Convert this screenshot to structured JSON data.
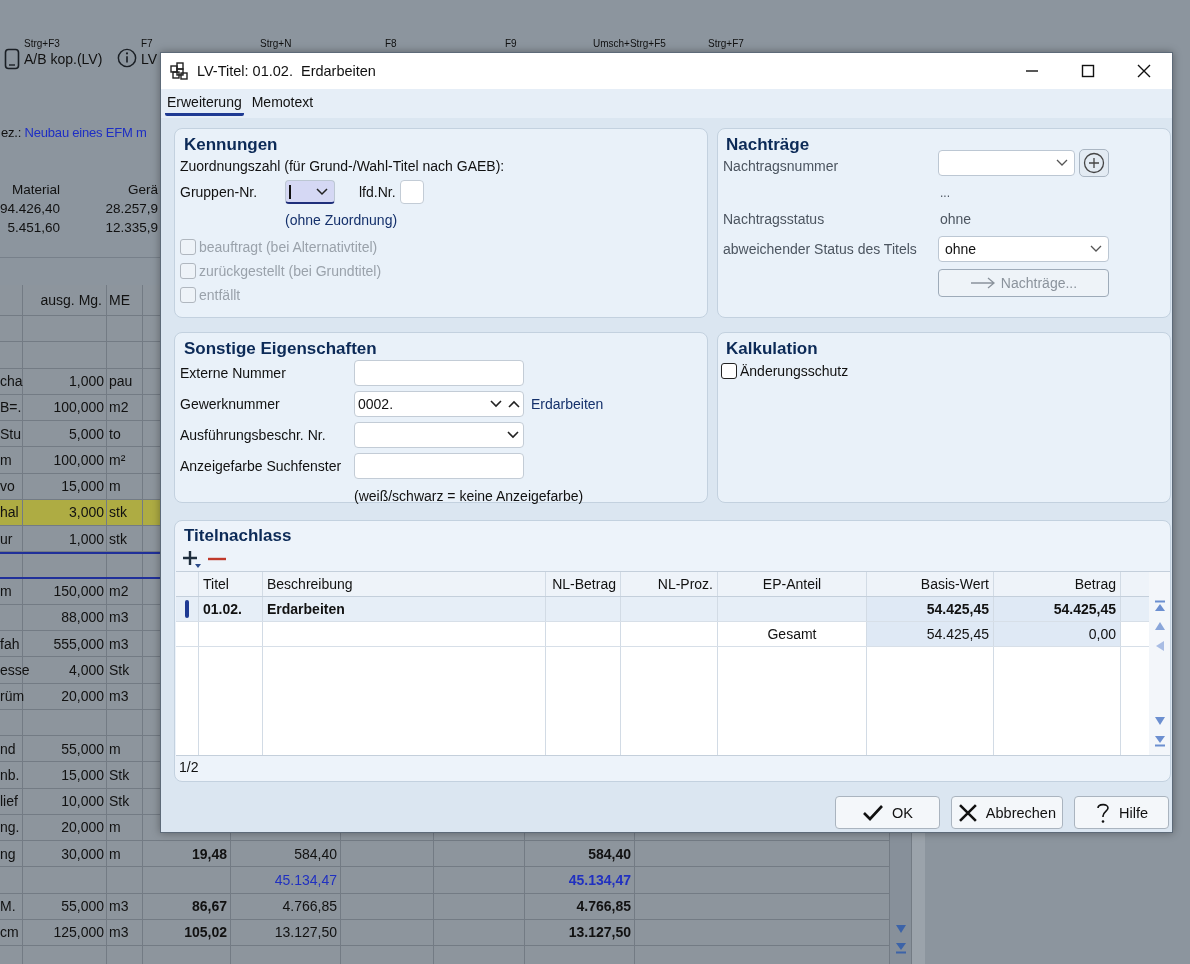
{
  "background": {
    "toolbar": [
      {
        "shortcut": "Strg+F3",
        "label": "A/B kop.(LV)"
      },
      {
        "shortcut": "F7",
        "label": "LV"
      },
      {
        "shortcut": "Strg+N"
      },
      {
        "shortcut": "F8"
      },
      {
        "shortcut": "F9"
      },
      {
        "shortcut": "Umsch+Strg+F5"
      },
      {
        "shortcut": "Strg+F7"
      }
    ],
    "project": {
      "label": "ez.:",
      "name": "Neubau eines EFM m"
    },
    "summary": {
      "columns": [
        "Material",
        "Gerä"
      ],
      "rows": [
        [
          "94.426,40",
          "28.257,9"
        ],
        [
          "5.451,60",
          "12.335,9"
        ]
      ]
    },
    "table": {
      "header": {
        "qty": "ausg. Mg.",
        "unit": "ME"
      },
      "rows": [
        {
          "kind": "item",
          "highlighted": false
        },
        {
          "kind": "item",
          "highlighted": false
        },
        {
          "kind": "item",
          "highlighted": false,
          "column_1": "cha",
          "qty": "1,000",
          "unit": "pau"
        },
        {
          "kind": "item",
          "highlighted": false,
          "column_1": "B=.",
          "qty": "100,000",
          "unit": "m2"
        },
        {
          "kind": "item",
          "highlighted": false,
          "column_1": "Stu",
          "qty": "5,000",
          "unit": "to"
        },
        {
          "kind": "item",
          "highlighted": false,
          "column_1": "m",
          "qty": "100,000",
          "unit": "m²"
        },
        {
          "kind": "item",
          "highlighted": false,
          "column_1": "vo",
          "qty": "15,000",
          "unit": "m"
        },
        {
          "kind": "item",
          "highlighted": true,
          "column_1": "hal",
          "qty": "3,000",
          "unit": "stk"
        },
        {
          "kind": "item",
          "highlighted": false,
          "column_1": "ur",
          "qty": "1,000",
          "unit": "stk"
        },
        {
          "kind": "group",
          "highlighted": false
        },
        {
          "kind": "item",
          "highlighted": false,
          "column_1": "m",
          "qty": "150,000",
          "unit": "m2"
        },
        {
          "kind": "item",
          "highlighted": false,
          "qty": "88,000",
          "unit": "m3"
        },
        {
          "kind": "item",
          "highlighted": false,
          "column_1": "fah",
          "qty": "555,000",
          "unit": "m3"
        },
        {
          "kind": "item",
          "highlighted": false,
          "column_1": "esse",
          "qty": "4,000",
          "unit": "Stk"
        },
        {
          "kind": "item",
          "highlighted": false,
          "column_1": "rüm",
          "qty": "20,000",
          "unit": "m3"
        },
        {
          "kind": "item",
          "highlighted": false
        },
        {
          "kind": "item",
          "highlighted": false,
          "column_1": "nd",
          "qty": "55,000",
          "unit": "m"
        },
        {
          "kind": "item",
          "highlighted": false,
          "column_1": "nb.",
          "qty": "15,000",
          "unit": "Stk"
        },
        {
          "kind": "item",
          "highlighted": false,
          "column_1": "lief",
          "qty": "10,000",
          "unit": "Stk"
        },
        {
          "kind": "item",
          "highlighted": false,
          "column_1": "ng.",
          "qty": "20,000",
          "unit": "m"
        },
        {
          "kind": "item",
          "highlighted": false,
          "column_1": "ng",
          "qty": "30,000",
          "unit": "m",
          "column_4": "19,48",
          "column_5": "584,40",
          "column_8": "584,40"
        },
        {
          "kind": "subtotal",
          "highlighted": false,
          "column_5": "45.134,47",
          "column_8": "45.134,47"
        },
        {
          "kind": "item",
          "highlighted": false,
          "column_1": "M.",
          "qty": "55,000",
          "unit": "m3",
          "column_4": "86,67",
          "column_5": "4.766,85",
          "column_8": "4.766,85"
        },
        {
          "kind": "item",
          "highlighted": false,
          "column_1": "cm",
          "qty": "125,000",
          "unit": "m3",
          "column_4": "105,02",
          "column_5": "13.127,50",
          "column_8": "13.127,50"
        },
        {
          "kind": "item",
          "highlighted": false
        }
      ]
    }
  },
  "dialog": {
    "title": "LV-Titel: 01.02.  Erdarbeiten",
    "tabs": [
      {
        "label": "Erweiterung",
        "selected": true
      },
      {
        "label": "Memotext",
        "selected": false
      }
    ],
    "kennungen": {
      "heading": "Kennungen",
      "intro": "Zuordnungszahl (für Grund-/Wahl-Titel nach GAEB):",
      "gruppen_label": "Gruppen-Nr.",
      "gruppen_focused": true,
      "lfd_label": "lfd.Nr.",
      "note": "(ohne Zuordnung)",
      "checks": [
        {
          "label": "beauftragt (bei Alternativtitel)",
          "checked": false,
          "disabled": true
        },
        {
          "label": "zurückgestellt (bei Grundtitel)",
          "checked": false,
          "disabled": true
        },
        {
          "label": "entfällt",
          "checked": false,
          "disabled": true
        }
      ]
    },
    "nachtraege": {
      "heading": "Nachträge",
      "number_label": "Nachtragsnummer",
      "number_note": "...",
      "status_label": "Nachtragsstatus",
      "status_value": "ohne",
      "title_status_label": "abweichender Status des Titels",
      "title_status_value": "ohne",
      "button": {
        "label": "Nachträge...",
        "disabled": true
      }
    },
    "sonstige": {
      "heading": "Sonstige Eigenschaften",
      "fields": [
        {
          "label": "Externe Nummer",
          "kind": "text"
        },
        {
          "label": "Gewerknummer",
          "kind": "spin",
          "value": "0002.",
          "note": "Erdarbeiten"
        },
        {
          "label": "Ausführungsbeschr. Nr.",
          "kind": "combo"
        },
        {
          "label": "Anzeigefarbe Suchfenster",
          "kind": "text"
        }
      ],
      "hint": "(weiß/schwarz = keine Anzeigefarbe)"
    },
    "kalkulation": {
      "heading": "Kalkulation",
      "checks": [
        {
          "label": "Änderungsschutz",
          "checked": false,
          "disabled": false
        }
      ]
    },
    "titelnachlass": {
      "heading": "Titelnachlass",
      "columns": [
        "Titel",
        "Beschreibung",
        "NL-Betrag",
        "NL-Proz.",
        "EP-Anteil",
        "Basis-Wert",
        "Betrag"
      ],
      "rows": [
        {
          "kind": "item",
          "selected": true,
          "cells": [
            "01.02.",
            "Erdarbeiten",
            null,
            null,
            null,
            "54.425,45",
            "54.425,45"
          ]
        },
        {
          "kind": "total",
          "selected": false,
          "cells": [
            null,
            null,
            null,
            null,
            "Gesamt",
            "54.425,45",
            "0,00"
          ]
        }
      ],
      "pager": "1/2"
    },
    "buttons": [
      {
        "label": "OK",
        "kind": "ok"
      },
      {
        "label": "Abbrechen",
        "kind": "cancel"
      },
      {
        "label": "Hilfe",
        "kind": "help"
      }
    ]
  }
}
